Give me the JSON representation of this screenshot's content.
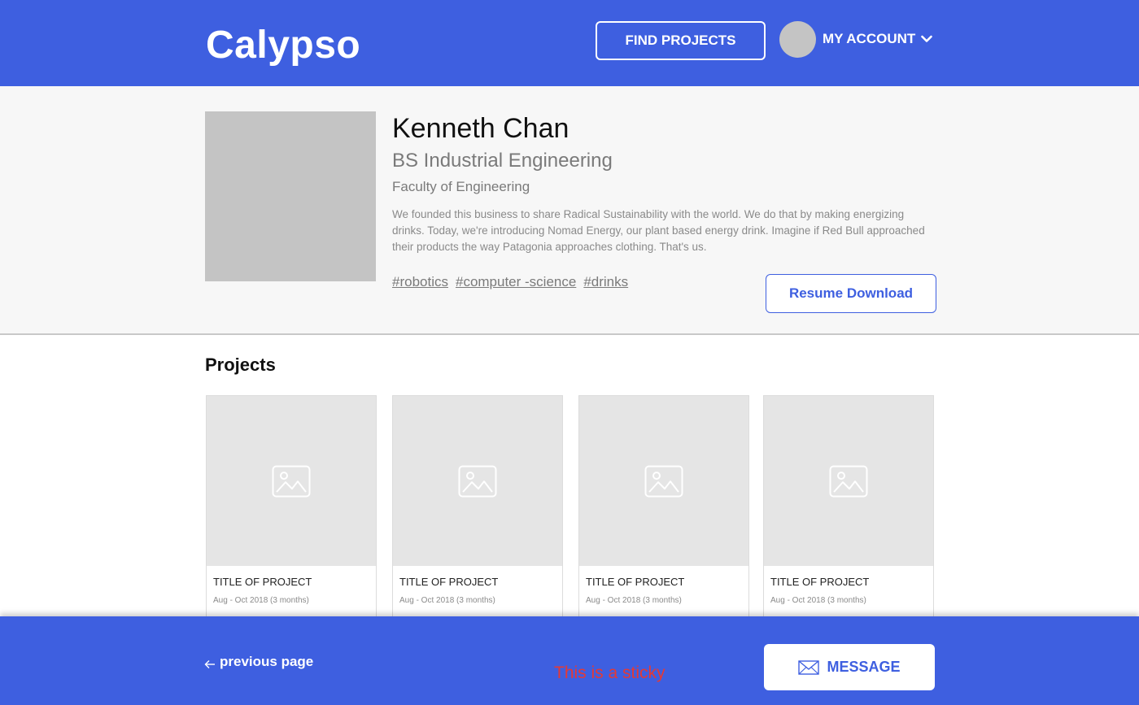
{
  "header": {
    "logo": "Calypso",
    "find_projects": "FIND PROJECTS",
    "account_label": "MY ACCOUNT"
  },
  "profile": {
    "name": "Kenneth Chan",
    "degree": "BS Industrial Engineering",
    "faculty": "Faculty of Engineering",
    "bio": "We founded this business to share Radical Sustainability with the world. We do that by making energizing drinks. Today, we're introducing Nomad Energy, our plant based energy drink.  Imagine if Red Bull approached their products the way Patagonia approaches clothing. That's us.",
    "tags": [
      "#robotics",
      "#computer -science",
      "#drinks"
    ],
    "resume_button": "Resume Download"
  },
  "projects": {
    "heading": "Projects",
    "items": [
      {
        "title": "TITLE OF PROJECT",
        "date": "Aug - Oct  2018 (3 months)"
      },
      {
        "title": "TITLE OF PROJECT",
        "date": "Aug - Oct  2018 (3 months)"
      },
      {
        "title": "TITLE OF PROJECT",
        "date": "Aug - Oct  2018 (3 months)"
      },
      {
        "title": "TITLE OF PROJECT",
        "date": "Aug - Oct  2018 (3 months)"
      }
    ]
  },
  "footer": {
    "prev_page": "previous page",
    "sticky_note": "This is a sticky",
    "message_button": "MESSAGE"
  },
  "colors": {
    "brand": "#3e5fe0",
    "sticky_note": "#e53935"
  },
  "icons": [
    "chevron-down-icon",
    "image-placeholder-icon",
    "arrow-left-icon",
    "envelope-icon"
  ]
}
